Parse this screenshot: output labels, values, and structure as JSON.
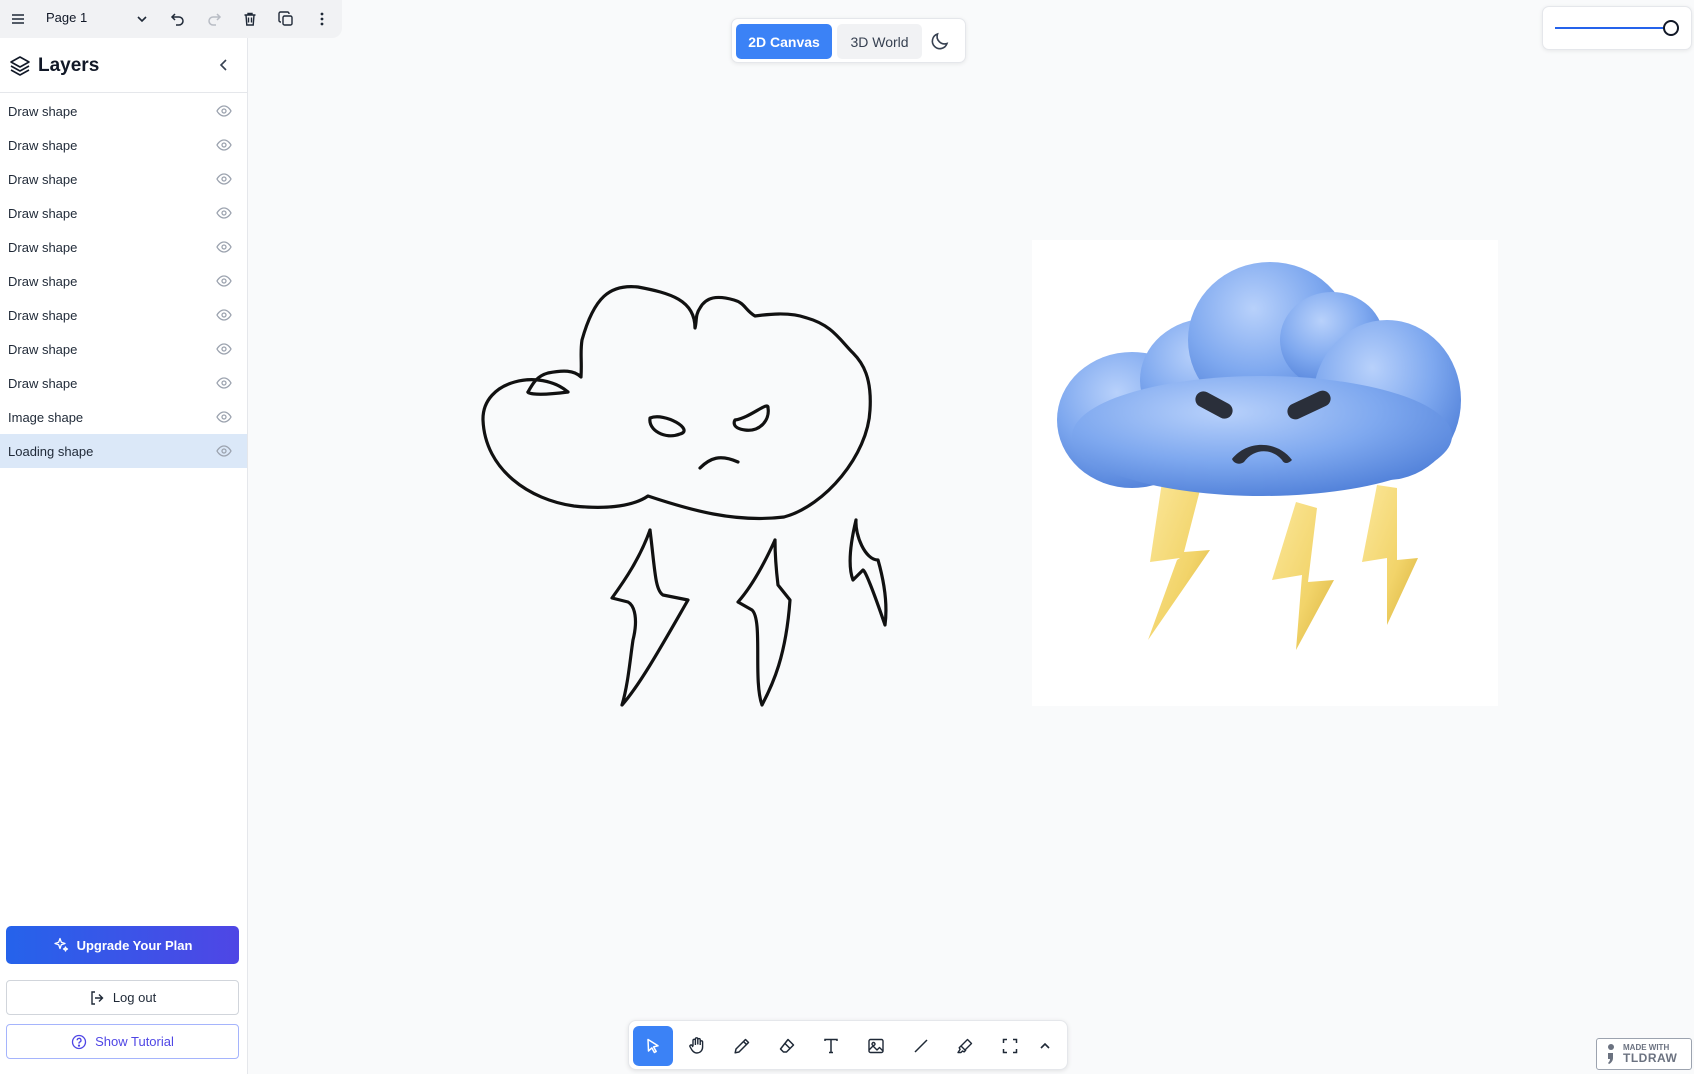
{
  "page_bar": {
    "page_name": "Page 1",
    "icons": [
      "menu-icon",
      "chevron-down-icon",
      "undo-icon",
      "redo-icon",
      "trash-icon",
      "duplicate-icon",
      "more-vertical-icon"
    ]
  },
  "layers": {
    "title": "Layers",
    "items": [
      {
        "label": "Draw shape",
        "selected": false
      },
      {
        "label": "Draw shape",
        "selected": false
      },
      {
        "label": "Draw shape",
        "selected": false
      },
      {
        "label": "Draw shape",
        "selected": false
      },
      {
        "label": "Draw shape",
        "selected": false
      },
      {
        "label": "Draw shape",
        "selected": false
      },
      {
        "label": "Draw shape",
        "selected": false
      },
      {
        "label": "Draw shape",
        "selected": false
      },
      {
        "label": "Draw shape",
        "selected": false
      },
      {
        "label": "Image shape",
        "selected": false
      },
      {
        "label": "Loading shape",
        "selected": true
      }
    ]
  },
  "account": {
    "upgrade_label": "Upgrade Your Plan",
    "logout_label": "Log out",
    "tutorial_label": "Show Tutorial"
  },
  "mode_toggle": {
    "active_label": "2D Canvas",
    "inactive_label": "3D World"
  },
  "zoom": {
    "level_fraction": 1.0
  },
  "toolbar": {
    "tools": [
      "select-icon",
      "hand-icon",
      "pencil-icon",
      "eraser-icon",
      "text-icon",
      "image-icon",
      "line-icon",
      "highlighter-icon",
      "frame-icon",
      "chevron-up-icon"
    ],
    "active_tool": "select"
  },
  "badge": {
    "line1": "MADE WITH",
    "line2": "TLDRAW"
  },
  "colors": {
    "accent": "#3b82f6",
    "upgrade_start": "#2563eb",
    "upgrade_end": "#4f46e5",
    "selected_row": "#dbe8f8",
    "canvas_bg": "#f9fafb",
    "cloud_blue": "#7ea8ef",
    "bolt_yellow": "#f2d46a"
  }
}
